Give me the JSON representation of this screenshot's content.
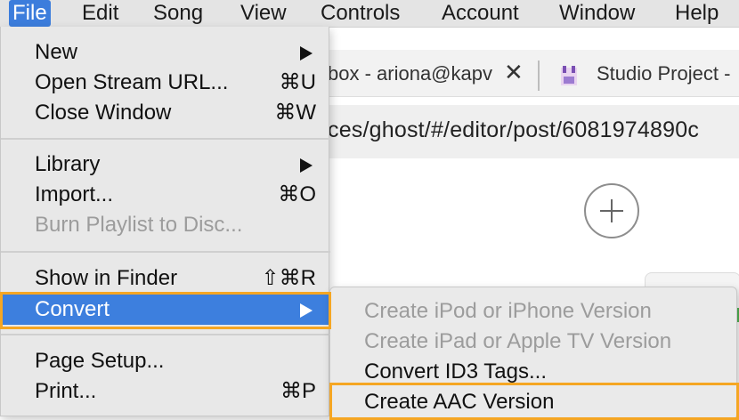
{
  "menubar": {
    "items": [
      "File",
      "Edit",
      "Song",
      "View",
      "Controls",
      "Account",
      "Window",
      "Help"
    ],
    "active_index": 0
  },
  "browser": {
    "tab1_text": "box - ariona@kapv",
    "tab2_text": "Studio Project -",
    "url_text": "ces/ghost/#/editor/post/6081974890c"
  },
  "file_menu": {
    "new": {
      "label": "New",
      "shortcut": ""
    },
    "open_stream": {
      "label": "Open Stream URL...",
      "shortcut": "⌘U"
    },
    "close_window": {
      "label": "Close Window",
      "shortcut": "⌘W"
    },
    "library": {
      "label": "Library",
      "shortcut": ""
    },
    "import": {
      "label": "Import...",
      "shortcut": "⌘O"
    },
    "burn": {
      "label": "Burn Playlist to Disc...",
      "shortcut": ""
    },
    "show_in_finder": {
      "label": "Show in Finder",
      "shortcut": "⇧⌘R"
    },
    "convert": {
      "label": "Convert",
      "shortcut": ""
    },
    "page_setup": {
      "label": "Page Setup...",
      "shortcut": ""
    },
    "print": {
      "label": "Print...",
      "shortcut": "⌘P"
    }
  },
  "convert_submenu": {
    "ipod": "Create iPod or iPhone Version",
    "ipad": "Create iPad or Apple TV Version",
    "id3": "Convert ID3 Tags...",
    "aac": "Create AAC Version"
  },
  "colors": {
    "highlight": "#3d7fde",
    "callout": "#f5a623",
    "disabled_text": "#9c9c9c"
  },
  "icons": {
    "tab_close": "close-icon",
    "favicon": "studio-favicon-icon",
    "add": "plus-icon",
    "submenu_arrow": "triangle-right-icon"
  }
}
